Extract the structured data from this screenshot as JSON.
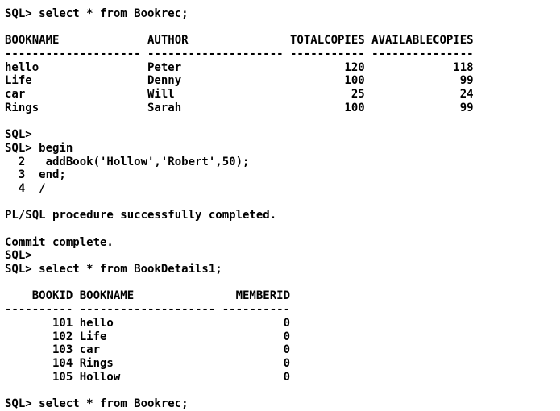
{
  "terminal": {
    "lines": [
      "SQL> select * from Bookrec;",
      "",
      "BOOKNAME             AUTHOR               TOTALCOPIES AVAILABLECOPIES",
      "-------------------- -------------------- ----------- ---------------",
      "hello                Peter                        120             118",
      "Life                 Denny                        100              99",
      "car                  Will                          25              24",
      "Rings                Sarah                        100              99",
      "",
      "SQL>",
      "SQL> begin",
      "  2   addBook('Hollow','Robert',50);",
      "  3  end;",
      "  4  /",
      "",
      "PL/SQL procedure successfully completed.",
      "",
      "Commit complete.",
      "SQL>",
      "SQL> select * from BookDetails1;",
      "",
      "    BOOKID BOOKNAME               MEMBERID",
      "---------- -------------------- ----------",
      "       101 hello                         0",
      "       102 Life                          0",
      "       103 car                           0",
      "       104 Rings                         0",
      "       105 Hollow                        0",
      "",
      "SQL> select * from Bookrec;"
    ]
  }
}
